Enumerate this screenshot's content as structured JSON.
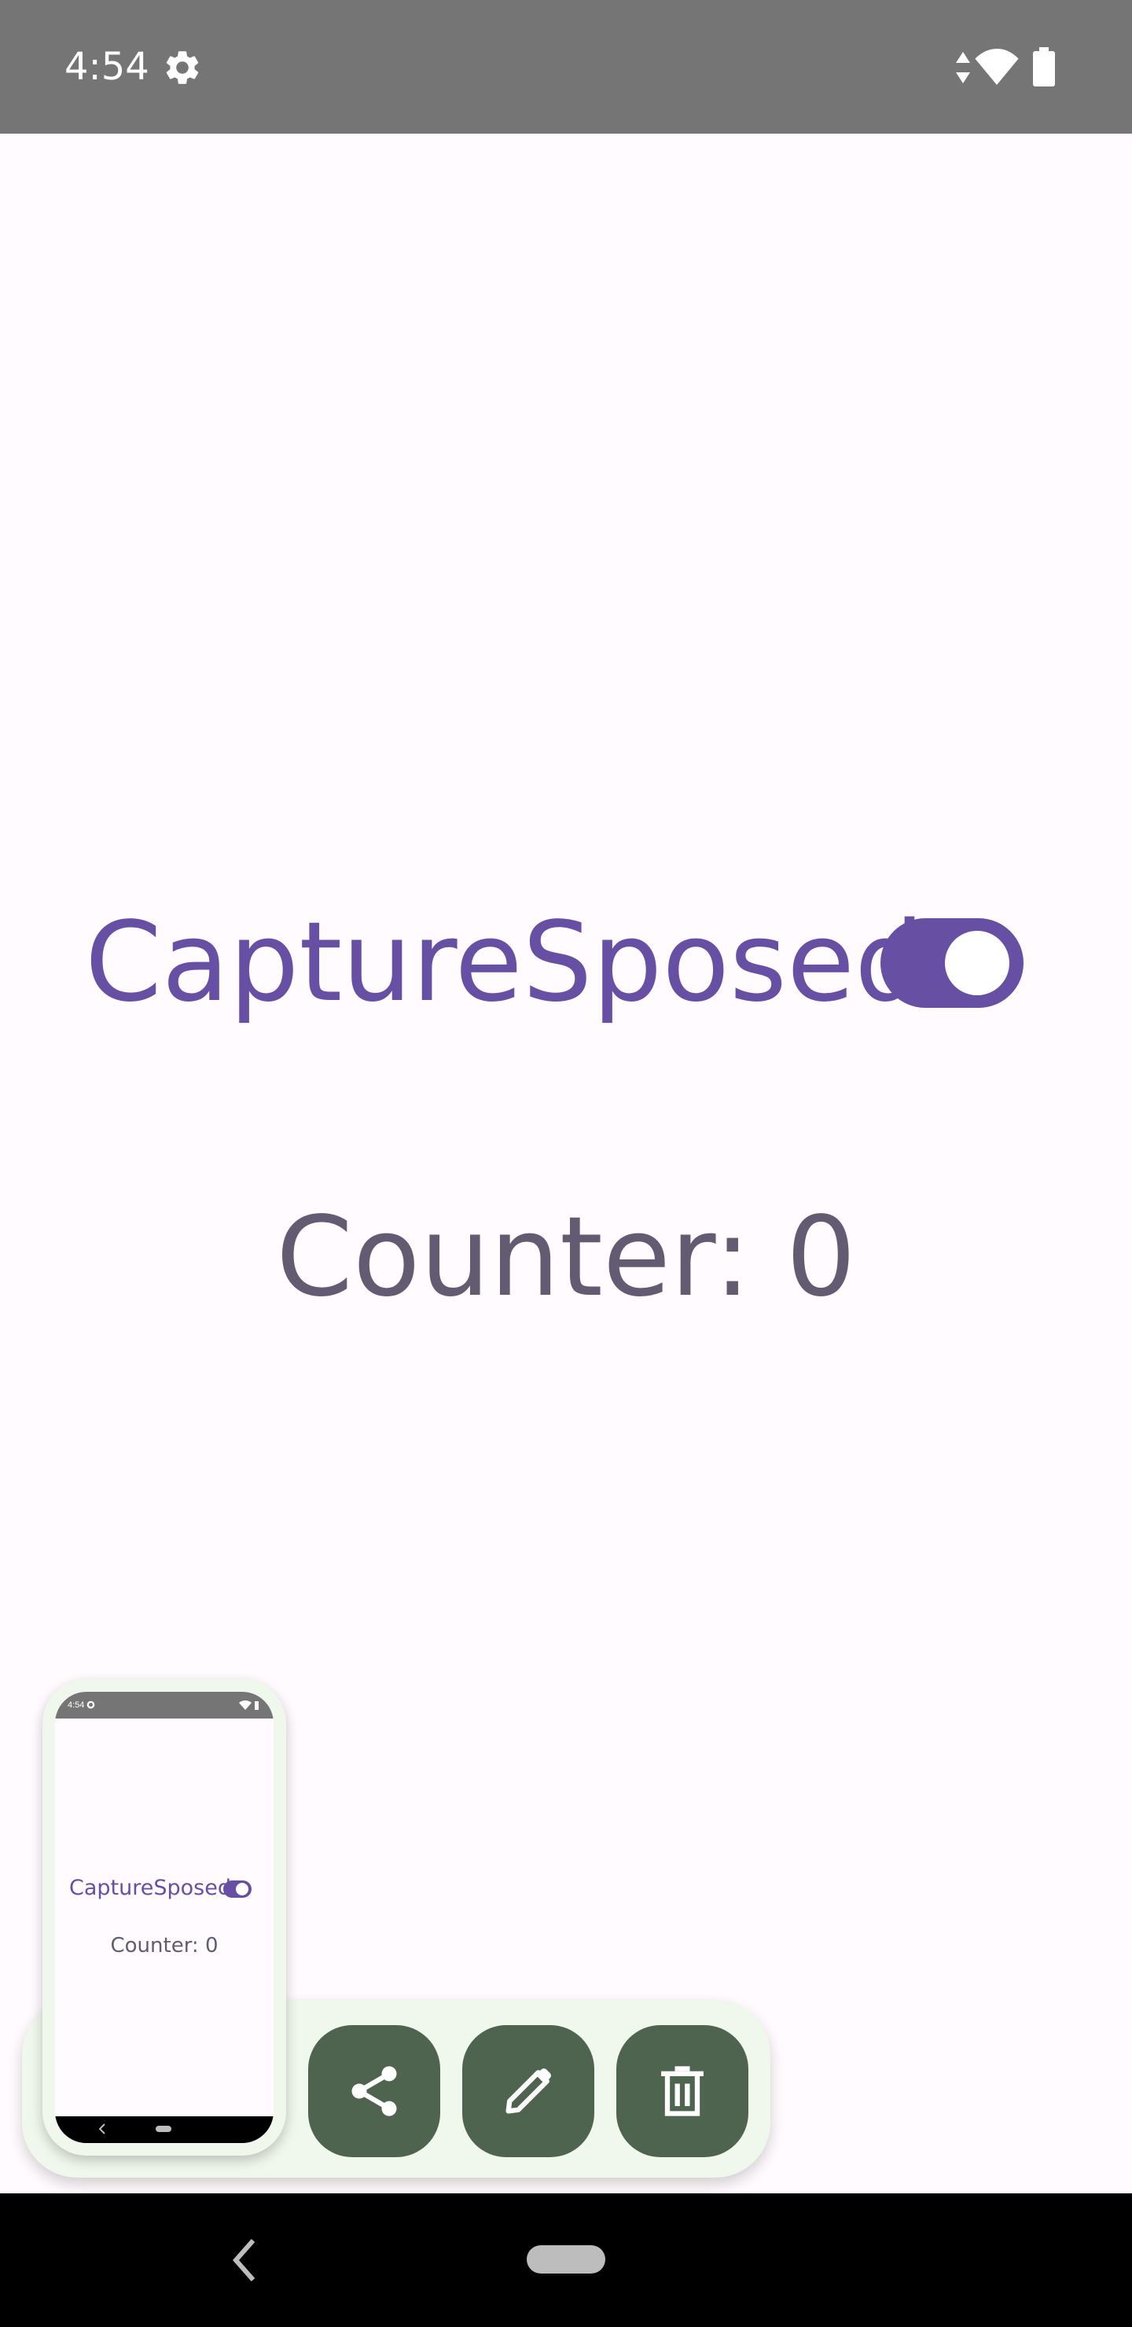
{
  "status_bar": {
    "time": "4:54",
    "icons": [
      "gear-icon",
      "data-arrows-icon",
      "wifi-icon",
      "battery-icon"
    ],
    "background": "#757575"
  },
  "main": {
    "title": "CaptureSposed",
    "toggle": {
      "on": true
    },
    "counter_text": "Counter: 0"
  },
  "thumbnail": {
    "time": "4:54",
    "title": "CaptureSposed",
    "counter_text": "Counter: 0"
  },
  "toolbar": {
    "buttons": [
      {
        "icon": "share-icon"
      },
      {
        "icon": "edit-icon"
      },
      {
        "icon": "delete-icon"
      }
    ],
    "button_color": "#4e644f",
    "background": "#f0f7ec"
  },
  "colors": {
    "accent": "#6750a4",
    "counter_text": "#625b71",
    "background": "#fffbfe"
  }
}
